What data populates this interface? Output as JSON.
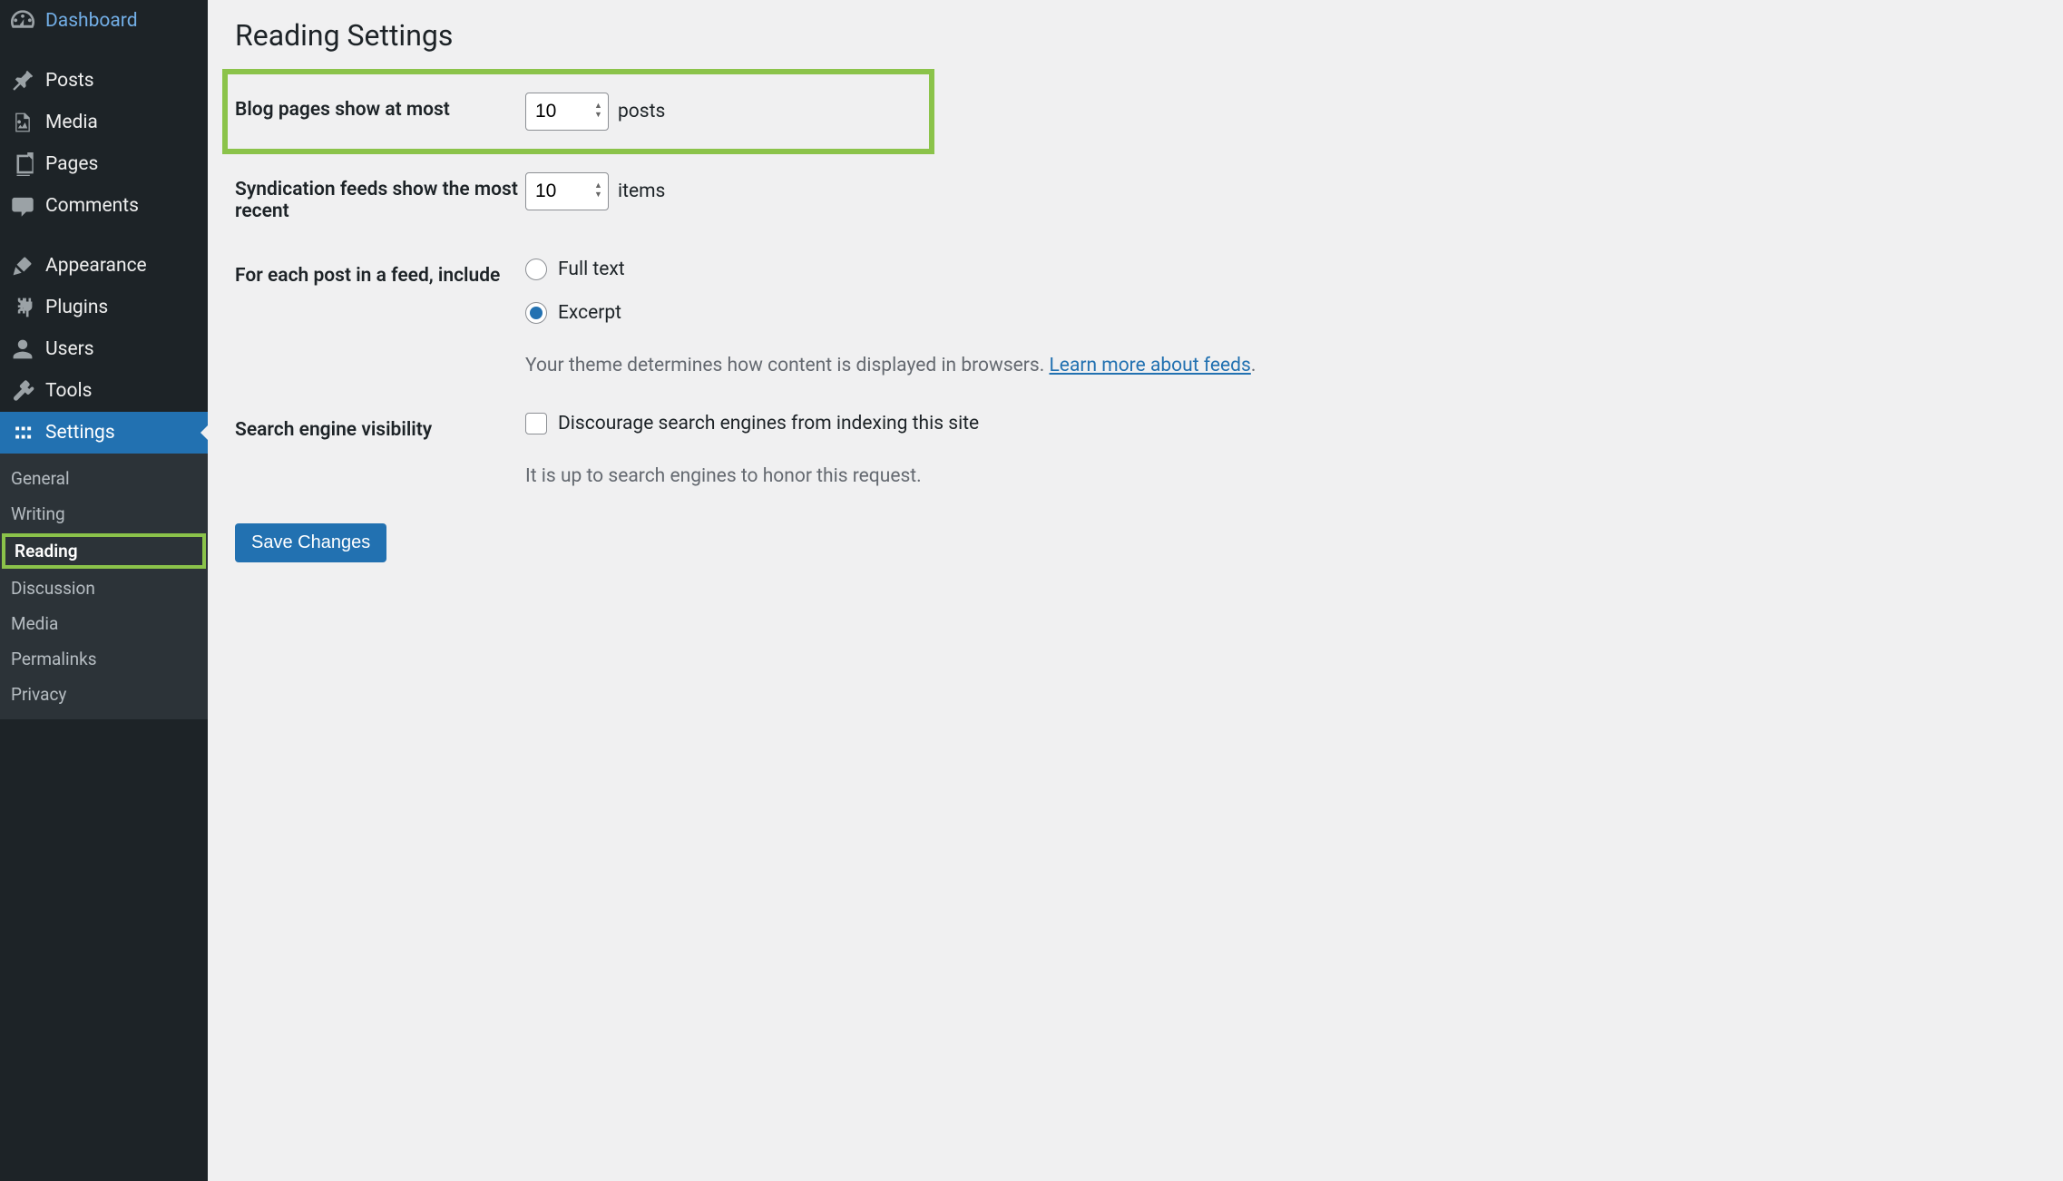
{
  "sidebar": {
    "items": [
      {
        "label": "Dashboard",
        "icon": "dashboard"
      },
      {
        "label": "Posts",
        "icon": "pin"
      },
      {
        "label": "Media",
        "icon": "media"
      },
      {
        "label": "Pages",
        "icon": "pages"
      },
      {
        "label": "Comments",
        "icon": "comments"
      },
      {
        "label": "Appearance",
        "icon": "appearance"
      },
      {
        "label": "Plugins",
        "icon": "plugins"
      },
      {
        "label": "Users",
        "icon": "users"
      },
      {
        "label": "Tools",
        "icon": "tools"
      },
      {
        "label": "Settings",
        "icon": "settings"
      }
    ],
    "submenu": {
      "items": [
        "General",
        "Writing",
        "Reading",
        "Discussion",
        "Media",
        "Permalinks",
        "Privacy"
      ]
    }
  },
  "page": {
    "title": "Reading Settings"
  },
  "fields": {
    "blog_pages": {
      "label": "Blog pages show at most",
      "value": "10",
      "unit": "posts"
    },
    "syndication": {
      "label": "Syndication feeds show the most recent",
      "value": "10",
      "unit": "items"
    },
    "feed_include": {
      "label": "For each post in a feed, include",
      "option_full": "Full text",
      "option_excerpt": "Excerpt",
      "selected": "excerpt",
      "description": "Your theme determines how content is displayed in browsers. ",
      "link_text": "Learn more about feeds",
      "period": "."
    },
    "search_visibility": {
      "label": "Search engine visibility",
      "checkbox_label": "Discourage search engines from indexing this site",
      "description": "It is up to search engines to honor this request."
    }
  },
  "buttons": {
    "save": "Save Changes"
  }
}
